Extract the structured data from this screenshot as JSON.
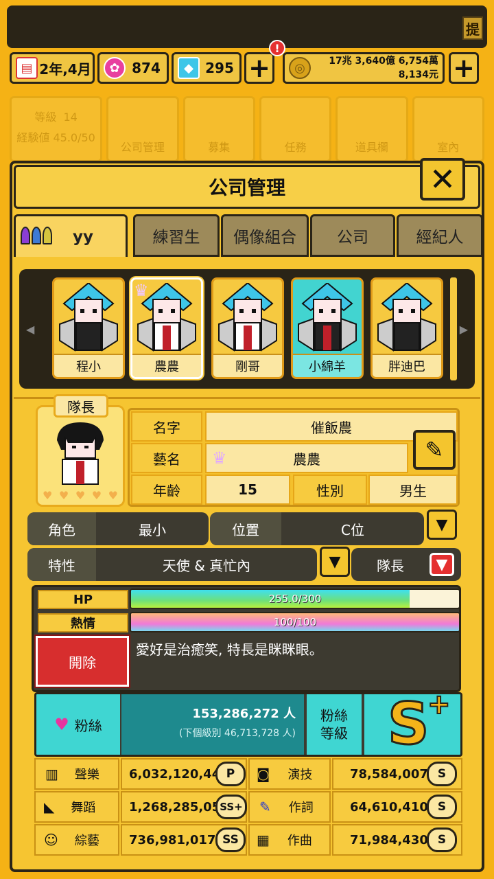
{
  "resources": {
    "date": "2年,4月",
    "gems_pink": "874",
    "gems_blue": "295",
    "money_line1": "17兆 3,640億 6,754萬",
    "money_line2": "8,134元",
    "plus": "+",
    "alert": "!"
  },
  "topbar": {
    "extra_label": "提"
  },
  "background_tiles": {
    "level_label": "等級",
    "level_value": "14",
    "exp_label": "経験値",
    "exp_value": "45.0/50",
    "items": [
      "公司管理",
      "募集",
      "任務",
      "道具欄",
      "室內"
    ]
  },
  "panel": {
    "title": "公司管理",
    "close": "✕"
  },
  "tabs": [
    {
      "label": "yy",
      "active": true
    },
    {
      "label": "練習生"
    },
    {
      "label": "偶像組合"
    },
    {
      "label": "公司"
    },
    {
      "label": "經紀人"
    }
  ],
  "roster": {
    "members": [
      {
        "name": "程小"
      },
      {
        "name": "農農"
      },
      {
        "name": "剛哥"
      },
      {
        "name": "小綿羊"
      },
      {
        "name": "胖迪巴"
      }
    ]
  },
  "profile": {
    "badge": "隊長",
    "name_label": "名字",
    "name_value": "催飯農",
    "stage_label": "藝名",
    "stage_value": "農農",
    "age_label": "年齡",
    "age_value": "15",
    "gender_label": "性別",
    "gender_value": "男生",
    "role_label": "角色",
    "role_value": "最小",
    "position_label": "位置",
    "position_value": "C位",
    "trait_label": "特性",
    "trait_value": "天使 & 真忙內",
    "leader_label": "隊長"
  },
  "bars": {
    "hp_label": "HP",
    "hp_text": "255.0/300",
    "hp_fraction": 0.85,
    "passion_label": "熱情",
    "passion_text": "100/100",
    "passion_fraction": 1.0,
    "fire_label": "開除",
    "description": "愛好是治癒笑, 特長是眯眯眼。"
  },
  "fans": {
    "label": "粉絲",
    "count": "153,286,272 人",
    "next": "(下個級別 46,713,728 人)",
    "level_label_1": "粉絲",
    "level_label_2": "等級",
    "grade": "S",
    "grade_plus": "+"
  },
  "stats": [
    {
      "label": "聲樂",
      "value": "6,032,120,443",
      "grade": "P"
    },
    {
      "label": "演技",
      "value": "78,584,007",
      "grade": "S"
    },
    {
      "label": "舞蹈",
      "value": "1,268,285,053",
      "grade": "SS+"
    },
    {
      "label": "作詞",
      "value": "64,610,410",
      "grade": "S"
    },
    {
      "label": "綜藝",
      "value": "736,981,017",
      "grade": "SS"
    },
    {
      "label": "作曲",
      "value": "71,984,430",
      "grade": "S"
    }
  ],
  "colors": {
    "bg": "#f5b215",
    "dark": "#2a2417",
    "fire_red": "#d72e2e",
    "teal": "#1e8a8e",
    "cyan": "#3fd6d2"
  }
}
